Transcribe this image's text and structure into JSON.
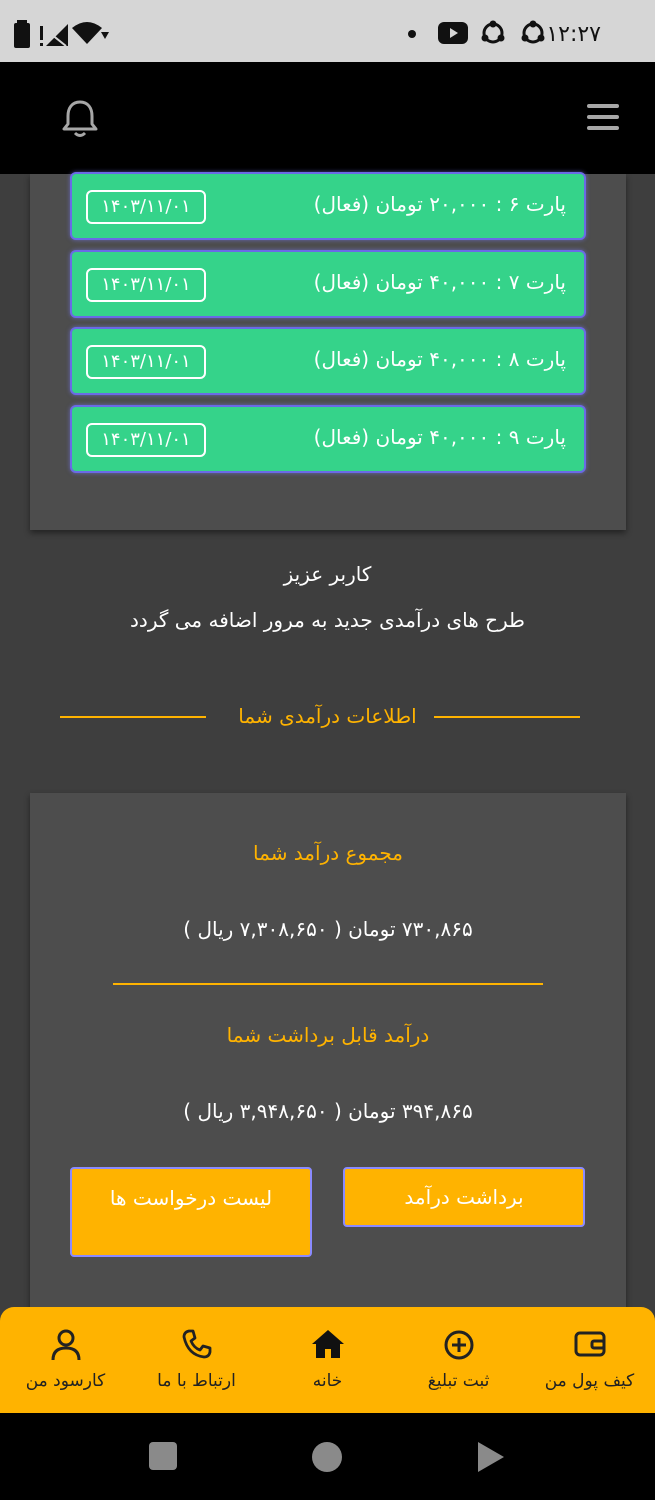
{
  "status_bar": {
    "time": "۱۲:۲۷"
  },
  "parts": [
    {
      "label": "پارت ۶ : ۲۰,۰۰۰ تومان (فعال)",
      "date": "۱۴۰۳/۱۱/۰۱"
    },
    {
      "label": "پارت ۷ : ۴۰,۰۰۰ تومان (فعال)",
      "date": "۱۴۰۳/۱۱/۰۱"
    },
    {
      "label": "پارت ۸ : ۴۰,۰۰۰ تومان (فعال)",
      "date": "۱۴۰۳/۱۱/۰۱"
    },
    {
      "label": "پارت ۹ : ۴۰,۰۰۰ تومان (فعال)",
      "date": "۱۴۰۳/۱۱/۰۱"
    }
  ],
  "message": {
    "line1": "کاربر عزیز",
    "line2": "طرح های درآمدی جدید به مرور اضافه می گردد"
  },
  "section_title": "اطلاعات درآمدی شما",
  "income": {
    "total_label": "مجموع درآمد شما",
    "total_value": "۷۳۰,۸۶۵ تومان ( ۷,۳۰۸,۶۵۰ ریال )",
    "withdrawable_label": "درآمد قابل برداشت شما",
    "withdrawable_value": "۳۹۴,۸۶۵ تومان ( ۳,۹۴۸,۶۵۰ ریال )",
    "withdraw_button": "برداشت درآمد",
    "requests_button": "لیست درخواست ها"
  },
  "bottom_nav": {
    "wallet": "کیف پول من",
    "post_ad": "ثبت تبلیغ",
    "home": "خانه",
    "contact": "ارتباط با ما",
    "profile": "کارسود من"
  },
  "colors": {
    "accent": "#ffb300",
    "active_green": "#35d38a",
    "header": "#000000",
    "card": "#4d4d4d"
  }
}
